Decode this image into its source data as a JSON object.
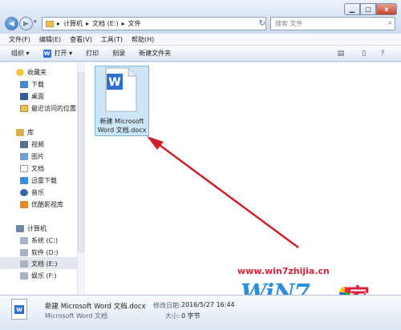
{
  "window": {
    "breadcrumb": [
      "计算机",
      "文档 (E:)",
      "文件"
    ],
    "search_placeholder": "搜索 文件",
    "min_glyph": "▁",
    "max_glyph": "□",
    "close_glyph": "x",
    "back_glyph": "◀",
    "fwd_glyph": "▶",
    "dd_glyph": "▾",
    "sep_glyph": "▸",
    "refresh_glyph": "↻"
  },
  "menu": [
    "文件(F)",
    "编辑(E)",
    "查看(V)",
    "工具(T)",
    "帮助(H)"
  ],
  "toolbar": {
    "organize": "组织 ▾",
    "open": "打开 ▾",
    "print": "打印",
    "burn": "刻录",
    "new_folder": "新建文件夹",
    "wps_glyph": "W"
  },
  "nav": {
    "favorites": "收藏夹",
    "downloads": "下载",
    "desktop": "桌面",
    "recent": "最近访问的位置",
    "libraries": "库",
    "videos": "视频",
    "pictures": "图片",
    "documents": "文档",
    "xunlei": "迅雷下载",
    "music": "音乐",
    "youku": "优酷影视库",
    "computer": "计算机",
    "drive_c": "系统 (C:)",
    "drive_d": "软件 (D:)",
    "drive_e": "文档 (E:)",
    "drive_f": "娱乐 (F:)"
  },
  "file": {
    "name_line1": "新建 Microsoft",
    "name_line2": "Word 文档.docx",
    "icon_glyph": "W"
  },
  "details": {
    "name": "新建 Microsoft Word 文档.docx",
    "type": "Microsoft Word 文档",
    "modified_label": "修改日期:",
    "modified_value": "2016/5/27 16:44",
    "size_label": "大小:",
    "size_value": "0 字节",
    "icon_glyph": "W"
  },
  "watermark": {
    "url": "www.win7zhijia.cn",
    "logo": "WiN7",
    "logo_suffix": "家"
  },
  "colors": {
    "arrow": "#d01f2a",
    "accent": "#2f6fd1"
  }
}
